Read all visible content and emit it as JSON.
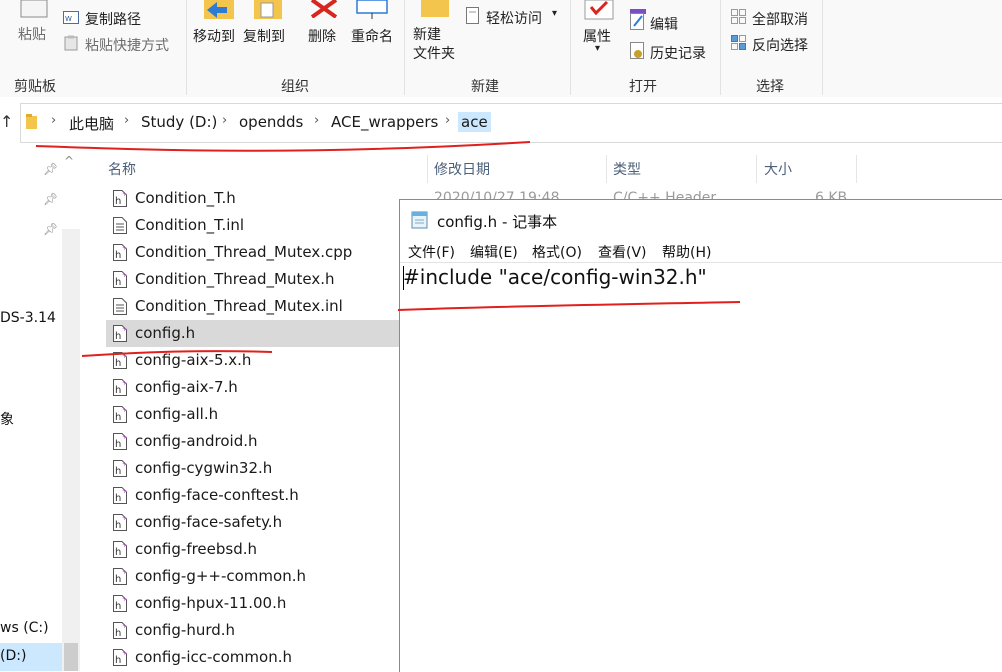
{
  "ribbon": {
    "clipboard": {
      "paste_label": "粘贴",
      "copy_path_label": "复制路径",
      "paste_shortcut_label": "粘贴快捷方式",
      "group_label": "剪贴板"
    },
    "organize": {
      "move_to_label": "移动到",
      "copy_to_label": "复制到",
      "delete_label": "删除",
      "rename_label": "重命名",
      "group_label": "组织"
    },
    "new": {
      "new_folder_label": "新建\n文件夹",
      "easy_access_label": "轻松访问",
      "group_label": "新建"
    },
    "open": {
      "properties_label": "属性",
      "edit_label": "编辑",
      "history_label": "历史记录",
      "group_label": "打开"
    },
    "select": {
      "select_none_label": "全部取消",
      "invert_label": "反向选择",
      "group_label": "选择"
    }
  },
  "address": {
    "crumbs": [
      "此电脑",
      "Study (D:)",
      "opendds",
      "ACE_wrappers",
      "ace"
    ]
  },
  "nav": {
    "partial_items": [
      "DS-3.14",
      "象",
      "ws (C:)",
      "(D:)"
    ]
  },
  "columns": {
    "name": "名称",
    "date": "修改日期",
    "type": "类型",
    "size": "大小"
  },
  "first_row_meta": {
    "date": "2020/10/27 19:48",
    "type": "C/C++ Header",
    "size": "6 KB"
  },
  "files": [
    "Condition_T.h",
    "Condition_T.inl",
    "Condition_Thread_Mutex.cpp",
    "Condition_Thread_Mutex.h",
    "Condition_Thread_Mutex.inl",
    "config.h",
    "config-aix-5.x.h",
    "config-aix-7.h",
    "config-all.h",
    "config-android.h",
    "config-cygwin32.h",
    "config-face-conftest.h",
    "config-face-safety.h",
    "config-freebsd.h",
    "config-g++-common.h",
    "config-hpux-11.00.h",
    "config-hurd.h",
    "config-icc-common.h"
  ],
  "notepad": {
    "title": "config.h - 记事本",
    "menu": [
      "文件(F)",
      "编辑(E)",
      "格式(O)",
      "查看(V)",
      "帮助(H)"
    ],
    "content": "#include \"ace/config-win32.h\""
  },
  "colors": {
    "selection": "#cce8ff",
    "selected_row": "#d9d9d9",
    "annotation": "#e0201c"
  }
}
